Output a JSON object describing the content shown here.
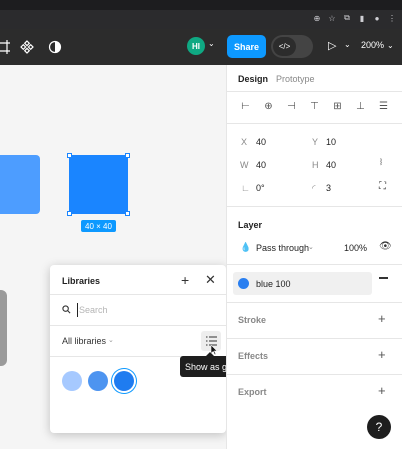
{
  "browser": {
    "icons": [
      "zoom-icon",
      "star-icon",
      "extension-icon",
      "sidebar-icon",
      "profile-icon",
      "menu-icon"
    ]
  },
  "toolbar": {
    "avatar_initials": "HI",
    "share_label": "Share",
    "zoom_label": "200%",
    "accent": "#0d99ff"
  },
  "canvas": {
    "selection_size_label": "40 × 40"
  },
  "libraries": {
    "title": "Libraries",
    "search_placeholder": "Search",
    "filter_label": "All libraries",
    "tooltip": "Show as grid",
    "swatches": [
      {
        "color": "#a6c9ff"
      },
      {
        "color": "#4d94f0"
      },
      {
        "color": "#1f7cf0"
      }
    ]
  },
  "panel": {
    "tabs": [
      "Design",
      "Prototype"
    ],
    "x_label": "X",
    "x_value": "40",
    "y_label": "Y",
    "y_value": "10",
    "w_label": "W",
    "w_value": "40",
    "h_label": "H",
    "h_value": "40",
    "rotation_value": "0°",
    "radius_value": "3",
    "layer_title": "Layer",
    "blend_mode": "Pass through",
    "opacity": "100%",
    "fill_name": "blue 100",
    "fill_color": "#2a7ff0",
    "stroke_title": "Stroke",
    "effects_title": "Effects",
    "export_title": "Export",
    "help": "?"
  }
}
